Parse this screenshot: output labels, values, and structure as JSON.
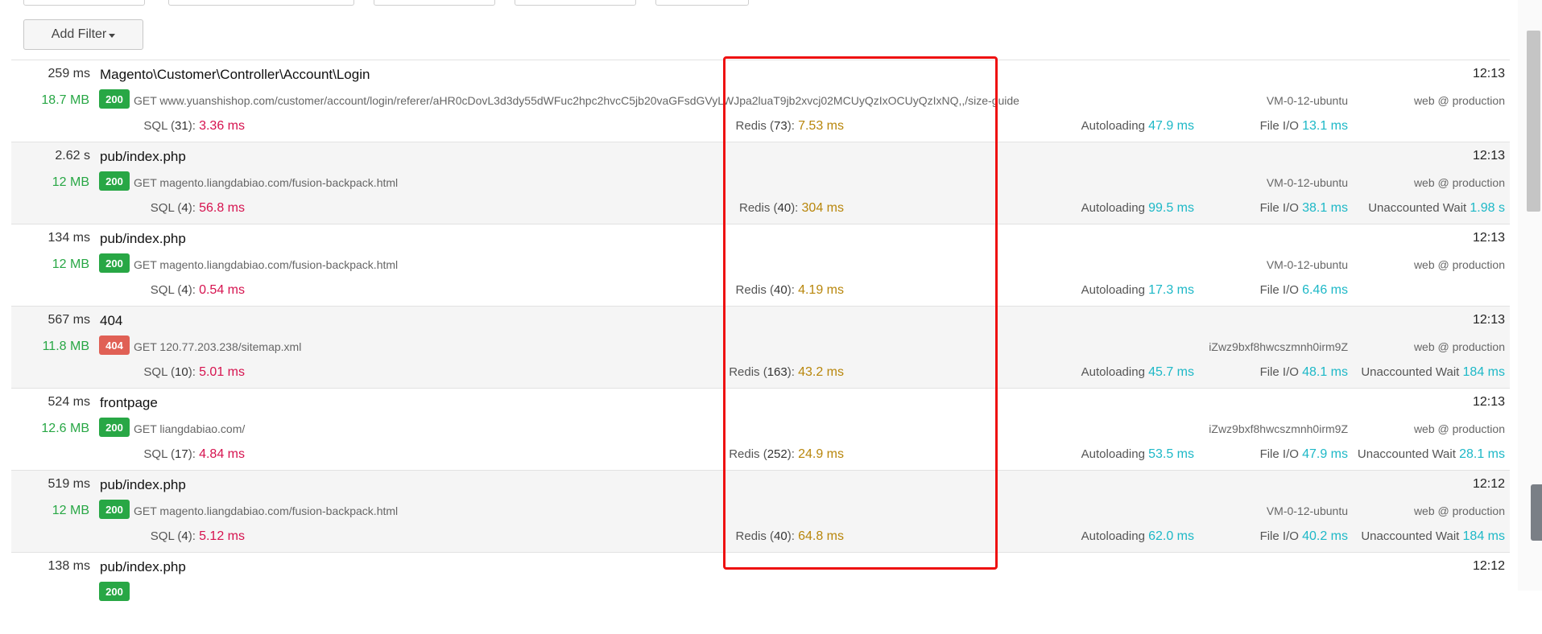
{
  "toolbar": {
    "add_filter_label": "Add Filter"
  },
  "requests": [
    {
      "duration": "259 ms",
      "memory": "18.7 MB",
      "name": "Magento\\Customer\\Controller\\Account\\Login",
      "status": "200",
      "url": "GET www.yuanshishop.com/customer/account/login/referer/aHR0cDovL3d3dy55dWFuc2hpc2hvcC5jb20vaGFsdGVyLWJpa2luaT9jb2xvcj02MCUyQzIxOCUyQzIxNQ,,/size-guide",
      "time": "12:13",
      "host": "VM-0-12-ubuntu",
      "env": "web @ production",
      "sql_label": "SQL (",
      "sql_count": "31",
      "sql_value": "3.36 ms",
      "redis_label": "Redis (",
      "redis_count": "73",
      "redis_value": "7.53 ms",
      "autoloading_label": "Autoloading",
      "autoloading_value": "47.9 ms",
      "fileio_label": "File I/O",
      "fileio_value": "13.1 ms",
      "wait_label": "",
      "wait_value": ""
    },
    {
      "duration": "2.62 s",
      "memory": "12 MB",
      "name": "pub/index.php",
      "status": "200",
      "url": "GET magento.liangdabiao.com/fusion-backpack.html",
      "time": "12:13",
      "host": "VM-0-12-ubuntu",
      "env": "web @ production",
      "sql_label": "SQL (",
      "sql_count": "4",
      "sql_value": "56.8 ms",
      "redis_label": "Redis (",
      "redis_count": "40",
      "redis_value": "304 ms",
      "autoloading_label": "Autoloading",
      "autoloading_value": "99.5 ms",
      "fileio_label": "File I/O",
      "fileio_value": "38.1 ms",
      "wait_label": "Unaccounted Wait",
      "wait_value": "1.98 s"
    },
    {
      "duration": "134 ms",
      "memory": "12 MB",
      "name": "pub/index.php",
      "status": "200",
      "url": "GET magento.liangdabiao.com/fusion-backpack.html",
      "time": "12:13",
      "host": "VM-0-12-ubuntu",
      "env": "web @ production",
      "sql_label": "SQL (",
      "sql_count": "4",
      "sql_value": "0.54 ms",
      "redis_label": "Redis (",
      "redis_count": "40",
      "redis_value": "4.19 ms",
      "autoloading_label": "Autoloading",
      "autoloading_value": "17.3 ms",
      "fileio_label": "File I/O",
      "fileio_value": "6.46 ms",
      "wait_label": "",
      "wait_value": ""
    },
    {
      "duration": "567 ms",
      "memory": "11.8 MB",
      "name": "404",
      "status": "404",
      "url": "GET 120.77.203.238/sitemap.xml",
      "time": "12:13",
      "host": "iZwz9bxf8hwcszmnh0irm9Z",
      "env": "web @ production",
      "sql_label": "SQL (",
      "sql_count": "10",
      "sql_value": "5.01 ms",
      "redis_label": "Redis (",
      "redis_count": "163",
      "redis_value": "43.2 ms",
      "autoloading_label": "Autoloading",
      "autoloading_value": "45.7 ms",
      "fileio_label": "File I/O",
      "fileio_value": "48.1 ms",
      "wait_label": "Unaccounted Wait",
      "wait_value": "184 ms"
    },
    {
      "duration": "524 ms",
      "memory": "12.6 MB",
      "name": "frontpage",
      "status": "200",
      "url": "GET liangdabiao.com/",
      "time": "12:13",
      "host": "iZwz9bxf8hwcszmnh0irm9Z",
      "env": "web @ production",
      "sql_label": "SQL (",
      "sql_count": "17",
      "sql_value": "4.84 ms",
      "redis_label": "Redis (",
      "redis_count": "252",
      "redis_value": "24.9 ms",
      "autoloading_label": "Autoloading",
      "autoloading_value": "53.5 ms",
      "fileio_label": "File I/O",
      "fileio_value": "47.9 ms",
      "wait_label": "Unaccounted Wait",
      "wait_value": "28.1 ms"
    },
    {
      "duration": "519 ms",
      "memory": "12 MB",
      "name": "pub/index.php",
      "status": "200",
      "url": "GET magento.liangdabiao.com/fusion-backpack.html",
      "time": "12:12",
      "host": "VM-0-12-ubuntu",
      "env": "web @ production",
      "sql_label": "SQL (",
      "sql_count": "4",
      "sql_value": "5.12 ms",
      "redis_label": "Redis (",
      "redis_count": "40",
      "redis_value": "64.8 ms",
      "autoloading_label": "Autoloading",
      "autoloading_value": "62.0 ms",
      "fileio_label": "File I/O",
      "fileio_value": "40.2 ms",
      "wait_label": "Unaccounted Wait",
      "wait_value": "184 ms"
    },
    {
      "duration": "138 ms",
      "memory": "",
      "name": "pub/index.php",
      "status": "200",
      "url": "",
      "time": "12:12",
      "host": "",
      "env": "",
      "sql_label": "",
      "sql_count": "",
      "sql_value": "",
      "redis_label": "",
      "redis_count": "",
      "redis_value": "",
      "autoloading_label": "",
      "autoloading_value": "",
      "fileio_label": "",
      "fileio_value": "",
      "wait_label": "",
      "wait_value": ""
    }
  ],
  "colors": {
    "sql": "#d6134f",
    "redis": "#b8860b",
    "cyan": "#1db8c7",
    "status_ok": "#28a745",
    "status_error": "#e06055",
    "highlight": "#ee1111"
  }
}
